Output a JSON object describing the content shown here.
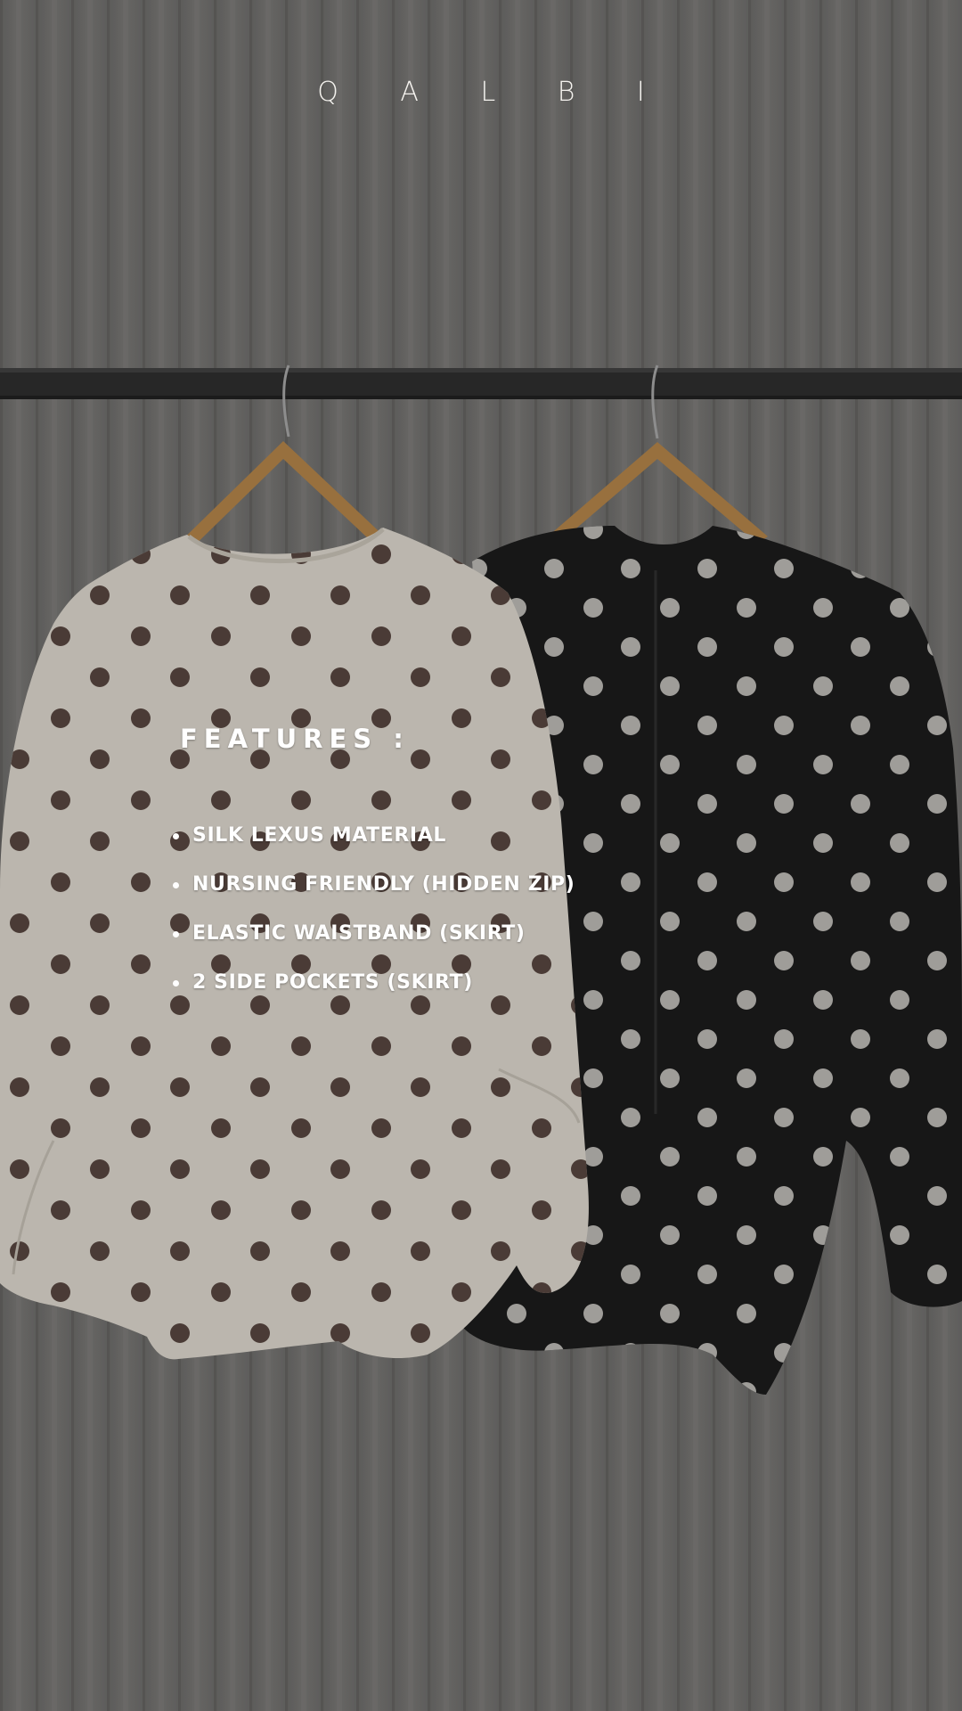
{
  "brand": "Q A L B I",
  "features": {
    "title": "FEATURES :",
    "items": [
      "SILK LEXUS MATERIAL",
      "NURSING FRIENDLY (HIDDEN ZIP)",
      "ELASTIC WAISTBAND (SKIRT)",
      "2 SIDE POCKETS (SKIRT)"
    ]
  },
  "photo": {
    "description_icon": "photo",
    "colors": {
      "backdrop": "#6c6b69",
      "rail": "#2c2c2c",
      "hanger": "#a87b45",
      "white_blouse": "#cfcac1",
      "white_dots": "#3a2a24",
      "black_blouse": "#1a1a1a",
      "black_dots": "#c9c7c3"
    }
  }
}
